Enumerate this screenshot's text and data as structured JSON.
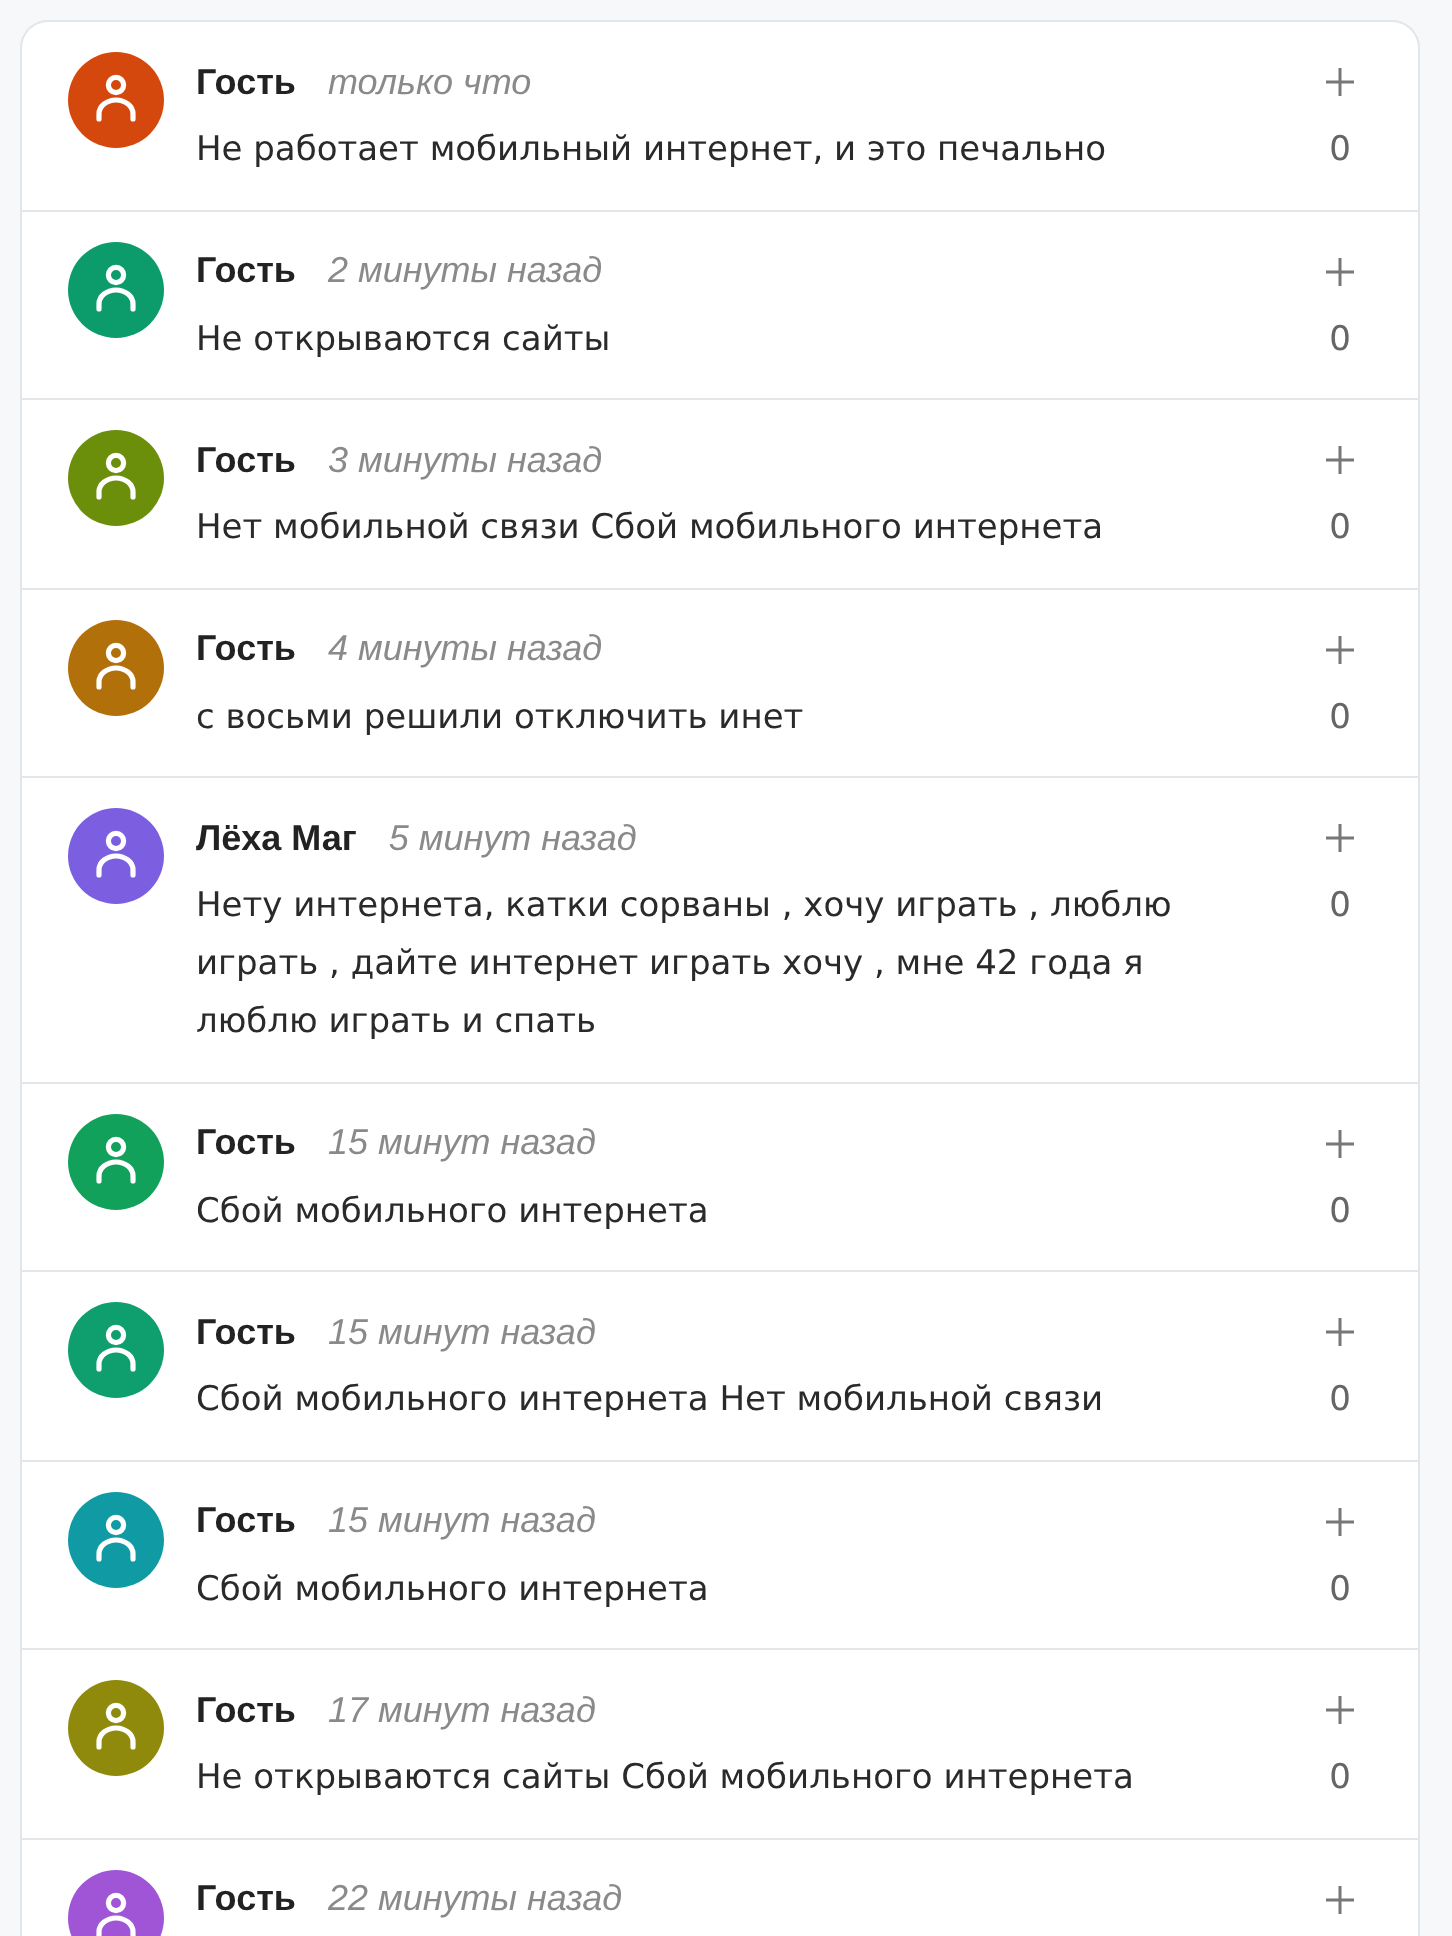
{
  "comments": [
    {
      "author": "Гость",
      "time": "только что",
      "text": "Не работает мобильный интернет, и это печально",
      "votes": "0",
      "color": "#d4470d"
    },
    {
      "author": "Гость",
      "time": "2 минуты назад",
      "text": "Не открываются сайты",
      "votes": "0",
      "color": "#0c9b6a"
    },
    {
      "author": "Гость",
      "time": "3 минуты назад",
      "text": "Нет мобильной связи Сбой мобильного интернета",
      "votes": "0",
      "color": "#6b8e0b"
    },
    {
      "author": "Гость",
      "time": "4 минуты назад",
      "text": "с восьми решили отключить инет",
      "votes": "0",
      "color": "#b2700a"
    },
    {
      "author": "Лёха Маг",
      "time": "5 минут назад",
      "text": "Нету интернета, катки сорваны , хочу играть , люблю играть , дайте интернет играть хочу , мне 42 года я люблю играть и спать",
      "votes": "0",
      "color": "#7c5fe0"
    },
    {
      "author": "Гость",
      "time": "15 минут назад",
      "text": "Сбой мобильного интернета",
      "votes": "0",
      "color": "#11a15a"
    },
    {
      "author": "Гость",
      "time": "15 минут назад",
      "text": "Сбой мобильного интернета Нет мобильной связи",
      "votes": "0",
      "color": "#0f9e6e"
    },
    {
      "author": "Гость",
      "time": "15 минут назад",
      "text": "Сбой мобильного интернета",
      "votes": "0",
      "color": "#0f9aa4"
    },
    {
      "author": "Гость",
      "time": "17 минут назад",
      "text": "Не открываются сайты Сбой мобильного интернета",
      "votes": "0",
      "color": "#8f8a0b"
    },
    {
      "author": "Гость",
      "time": "22 минуты назад",
      "color": "#a054d6"
    }
  ]
}
